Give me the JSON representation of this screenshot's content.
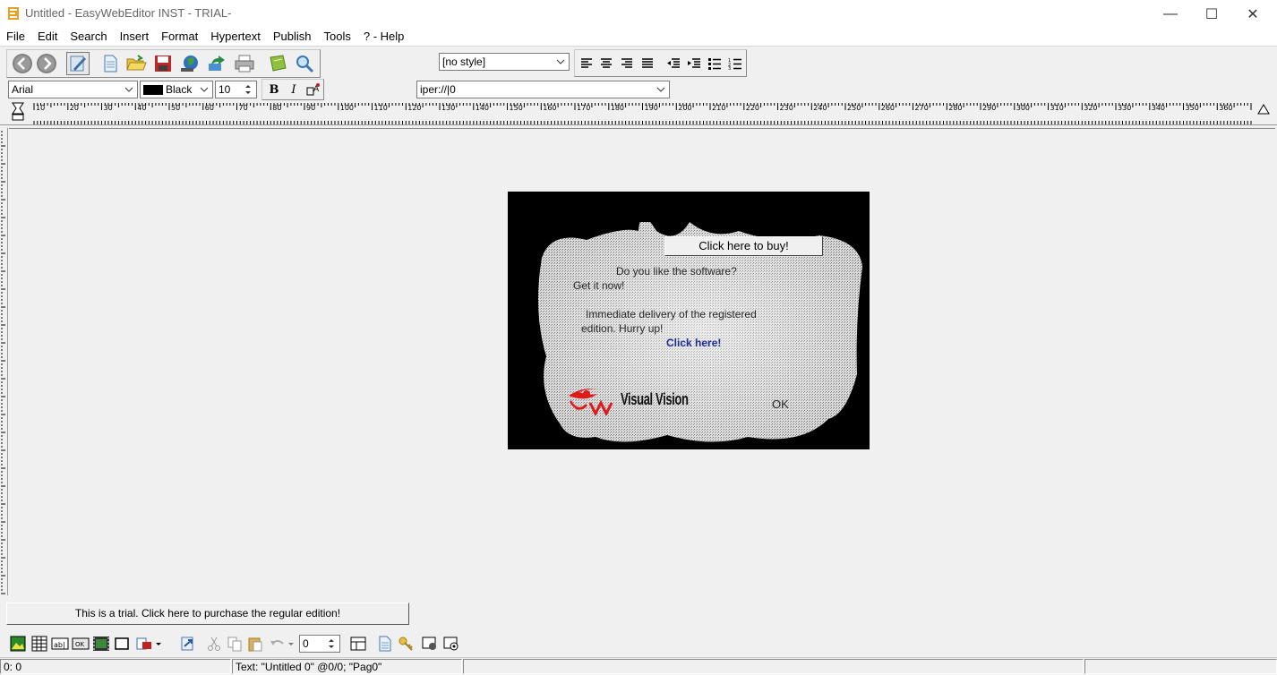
{
  "window": {
    "title": "Untitled - EasyWebEditor INST - TRIAL-",
    "minimize_glyph": "—",
    "maximize_glyph": "☐",
    "close_glyph": "✕"
  },
  "menu": [
    "File",
    "Edit",
    "Search",
    "Insert",
    "Format",
    "Hypertext",
    "Publish",
    "Tools",
    "? - Help"
  ],
  "toolbar": {
    "style_select": "[no style]",
    "font_select": "Arial",
    "color_select": "Black",
    "size_input": "10",
    "bold_label": "B",
    "italic_label": "I",
    "link_input": "iper://|0",
    "icons": [
      "back-icon",
      "forward-icon",
      "edit-mode-icon",
      "new-document-icon",
      "open-folder-icon",
      "save-icon",
      "publish-globe-icon",
      "upload-icon",
      "print-icon",
      "notebook-icon",
      "search-icon"
    ],
    "align_icons": [
      "align-left-icon",
      "align-center-icon",
      "align-right-icon",
      "align-justify-icon",
      "outdent-icon",
      "indent-icon",
      "bullet-list-icon",
      "numbered-list-icon"
    ]
  },
  "ruler": {
    "labels": [
      "10",
      "20",
      "30",
      "40",
      "50",
      "60",
      "70",
      "80",
      "90",
      "100",
      "110",
      "120",
      "130",
      "140",
      "150",
      "160",
      "170",
      "180",
      "190",
      "200",
      "210",
      "220",
      "230",
      "240",
      "250",
      "260",
      "270",
      "280",
      "290",
      "300",
      "310",
      "320",
      "330",
      "340",
      "350",
      "360"
    ]
  },
  "nag": {
    "buy_button": "Click here to buy!",
    "line1": "Do you like the software?",
    "line2": "Get it now!",
    "line3": "Immediate delivery of the registered",
    "line4": "edition. Hurry up!",
    "click_here": "Click here!",
    "brand": "Visual Vision",
    "ok": "OK"
  },
  "trial_button": "This is a trial. Click here to purchase the regular edition!",
  "bottom_toolbar": {
    "counter_value": "0",
    "icons": [
      "insert-image-icon",
      "insert-table-icon",
      "insert-textfield-icon",
      "insert-button-icon",
      "insert-video-icon",
      "insert-frame-icon",
      "insert-object-icon",
      "hyperlink-icon",
      "cut-icon",
      "copy-icon",
      "paste-icon",
      "undo-icon",
      "layout-icon",
      "page-icon",
      "properties-key-icon",
      "preview-icon",
      "settings-icon"
    ]
  },
  "status": {
    "position": "0: 0",
    "info": "Text: \"Untitled 0\" @0/0; \"Pag0\""
  },
  "colors": {
    "accent_red": "#e01a1a",
    "link_blue": "#1c2d9a"
  }
}
